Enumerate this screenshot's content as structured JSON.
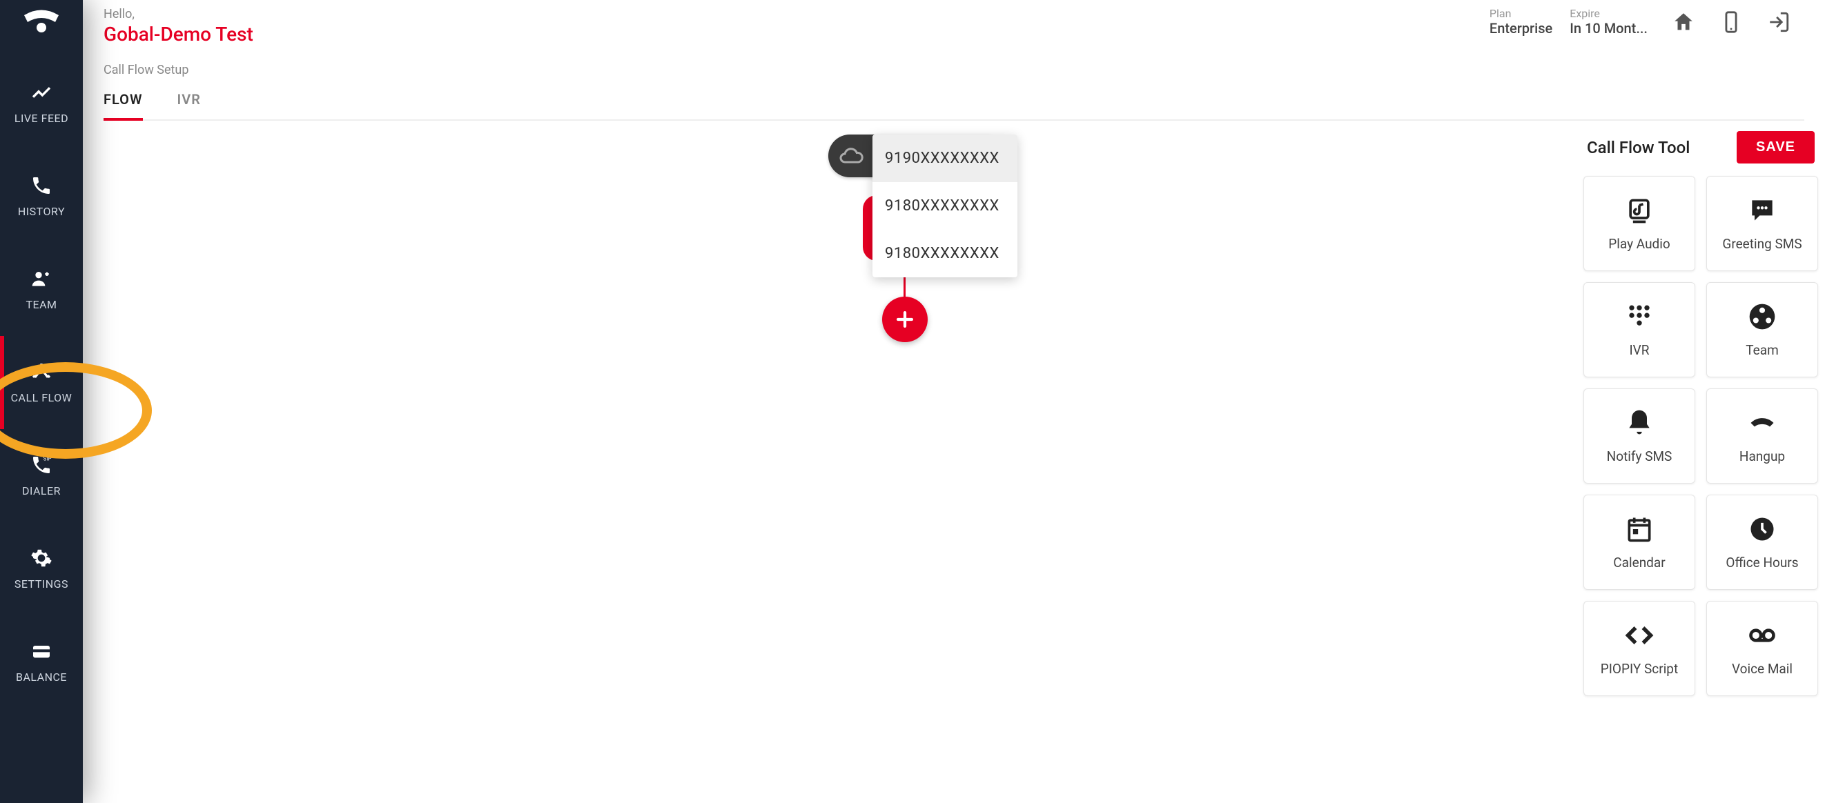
{
  "header": {
    "hello": "Hello,",
    "company": "Gobal-Demo Test",
    "plan_label": "Plan",
    "plan_value": "Enterprise",
    "expire_label": "Expire",
    "expire_value": "In 10 Mont..."
  },
  "breadcrumb": "Call Flow Setup",
  "tabs": {
    "flow": "FLOW",
    "ivr": "IVR"
  },
  "sidebar": {
    "live_feed": "LIVE FEED",
    "history": "HISTORY",
    "team": "TEAM",
    "call_flow": "CALL FLOW",
    "dialer": "DIALER",
    "settings": "SETTINGS",
    "balance": "BALANCE"
  },
  "dropdown": {
    "items": [
      "9190XXXXXXXX",
      "9180XXXXXXXX",
      "9180XXXXXXXX"
    ]
  },
  "toolbar": {
    "title": "Call Flow Tool",
    "save": "SAVE",
    "tools": {
      "play_audio": "Play Audio",
      "greeting_sms": "Greeting SMS",
      "ivr": "IVR",
      "team": "Team",
      "notify_sms": "Notify SMS",
      "hangup": "Hangup",
      "calendar": "Calendar",
      "office_hours": "Office Hours",
      "piopiy_script": "PIOPIY Script",
      "voice_mail": "Voice Mail"
    }
  }
}
